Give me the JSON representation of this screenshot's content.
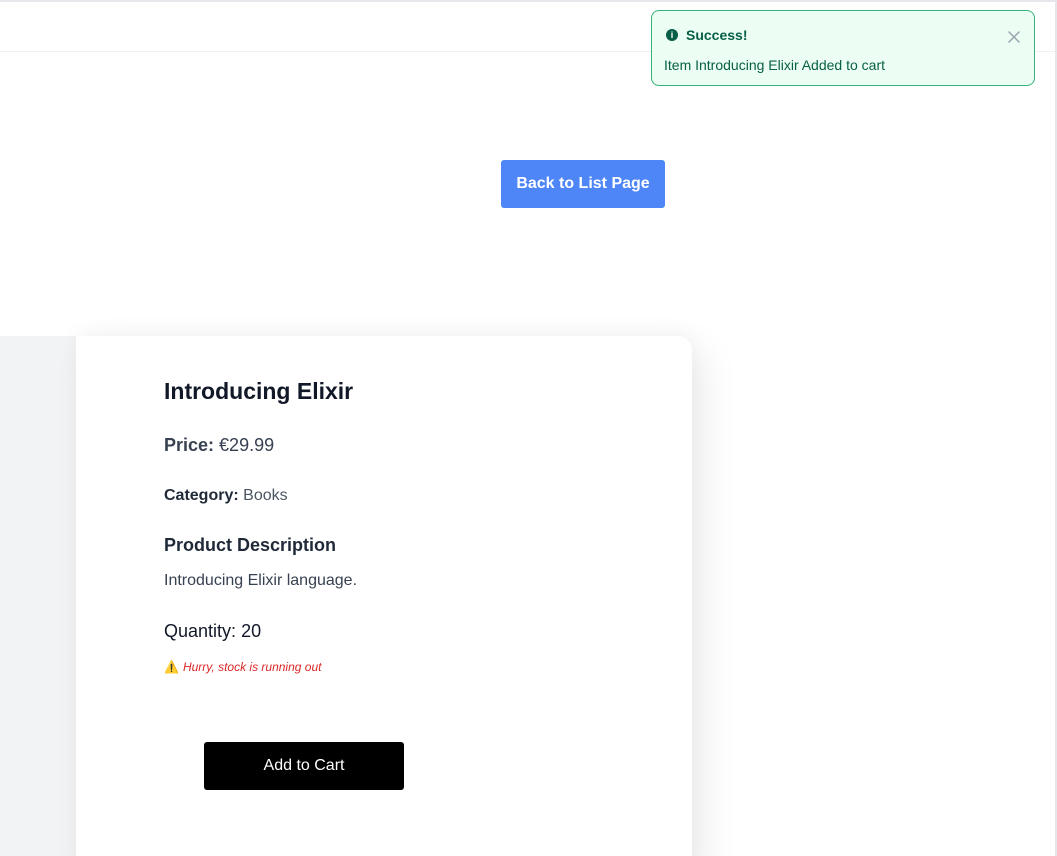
{
  "navigation": {
    "back_label": "Back to List Page"
  },
  "product": {
    "title": "Introducing Elixir",
    "price_label": "Price:",
    "price_value": "€29.99",
    "category_label": "Category:",
    "category_value": "Books",
    "description_heading": "Product Description",
    "description": "Introducing Elixir language.",
    "quantity_label": "Quantity:",
    "quantity_value": "20",
    "stock_warning_icon": "⚠️",
    "stock_warning": "Hurry, stock is running out",
    "add_to_cart_label": "Add to Cart"
  },
  "toast": {
    "icon": "info-circle-icon",
    "title": "Success!",
    "message": "Item Introducing Elixir Added to cart",
    "close_icon": "close-icon"
  },
  "colors": {
    "primary_button": "#4f86f7",
    "cart_button": "#000000",
    "toast_background": "#ecfdf3",
    "toast_border": "#34b27b",
    "toast_text": "#065f46",
    "warning_text": "#dc2626"
  }
}
